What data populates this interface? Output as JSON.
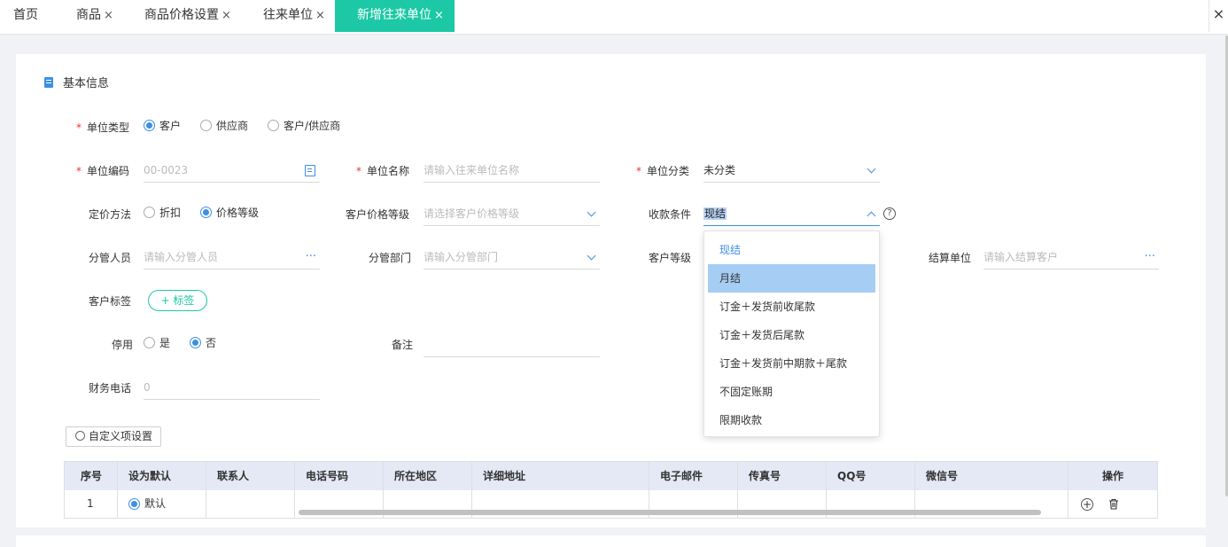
{
  "tabs": [
    {
      "label": "首页",
      "closable": false
    },
    {
      "label": "商品",
      "closable": true
    },
    {
      "label": "商品价格设置",
      "closable": true
    },
    {
      "label": "往来单位",
      "closable": true
    },
    {
      "label": "新增往来单位",
      "closable": true,
      "active": true
    }
  ],
  "close_glyph": "×",
  "section_title": "基本信息",
  "form": {
    "unit_type": {
      "label": "单位类型",
      "options": [
        "客户",
        "供应商",
        "客户/供应商"
      ],
      "selected": 0
    },
    "unit_code": {
      "label": "单位编码",
      "value": "00-0023"
    },
    "unit_name": {
      "label": "单位名称",
      "placeholder": "请输入往来单位名称"
    },
    "unit_category": {
      "label": "单位分类",
      "value": "未分类"
    },
    "pricing_method": {
      "label": "定价方法",
      "options": [
        "折扣",
        "价格等级"
      ],
      "selected": 1
    },
    "customer_price_level": {
      "label": "客户价格等级",
      "placeholder": "请选择客户价格等级"
    },
    "payment_terms": {
      "label": "收款条件",
      "value": "现结",
      "help": "?"
    },
    "manager": {
      "label": "分管人员",
      "placeholder": "请输入分管人员",
      "trail": "···"
    },
    "department": {
      "label": "分管部门",
      "placeholder": "请输入分管部门"
    },
    "customer_level": {
      "label": "客户等级"
    },
    "settlement_unit": {
      "label": "结算单位",
      "placeholder": "请输入结算客户",
      "trail": "···"
    },
    "customer_tags": {
      "label": "客户标签",
      "button": "+ 标签"
    },
    "disabled": {
      "label": "停用",
      "options": [
        "是",
        "否"
      ],
      "selected": 1
    },
    "remarks": {
      "label": "备注"
    },
    "finance_phone": {
      "label": "财务电话",
      "placeholder": "0"
    }
  },
  "payment_dropdown": {
    "items": [
      "现结",
      "月结",
      "订金＋发货前收尾款",
      "订金＋发货后尾款",
      "订金＋发货前中期款＋尾款",
      "不固定账期",
      "限期收款"
    ],
    "current": 0,
    "hovered": 1
  },
  "custom_settings_button": "自定义项设置",
  "contacts_table": {
    "columns": [
      "序号",
      "设为默认",
      "联系人",
      "电话号码",
      "所在地区",
      "详细地址",
      "电子邮件",
      "传真号",
      "QQ号",
      "微信号",
      "操作"
    ],
    "rows": [
      {
        "index": "1",
        "default_label": "默认",
        "is_default": true
      }
    ]
  },
  "colors": {
    "accent": "#1cc8a5",
    "primary": "#3c8fe6",
    "required": "#e53935"
  }
}
